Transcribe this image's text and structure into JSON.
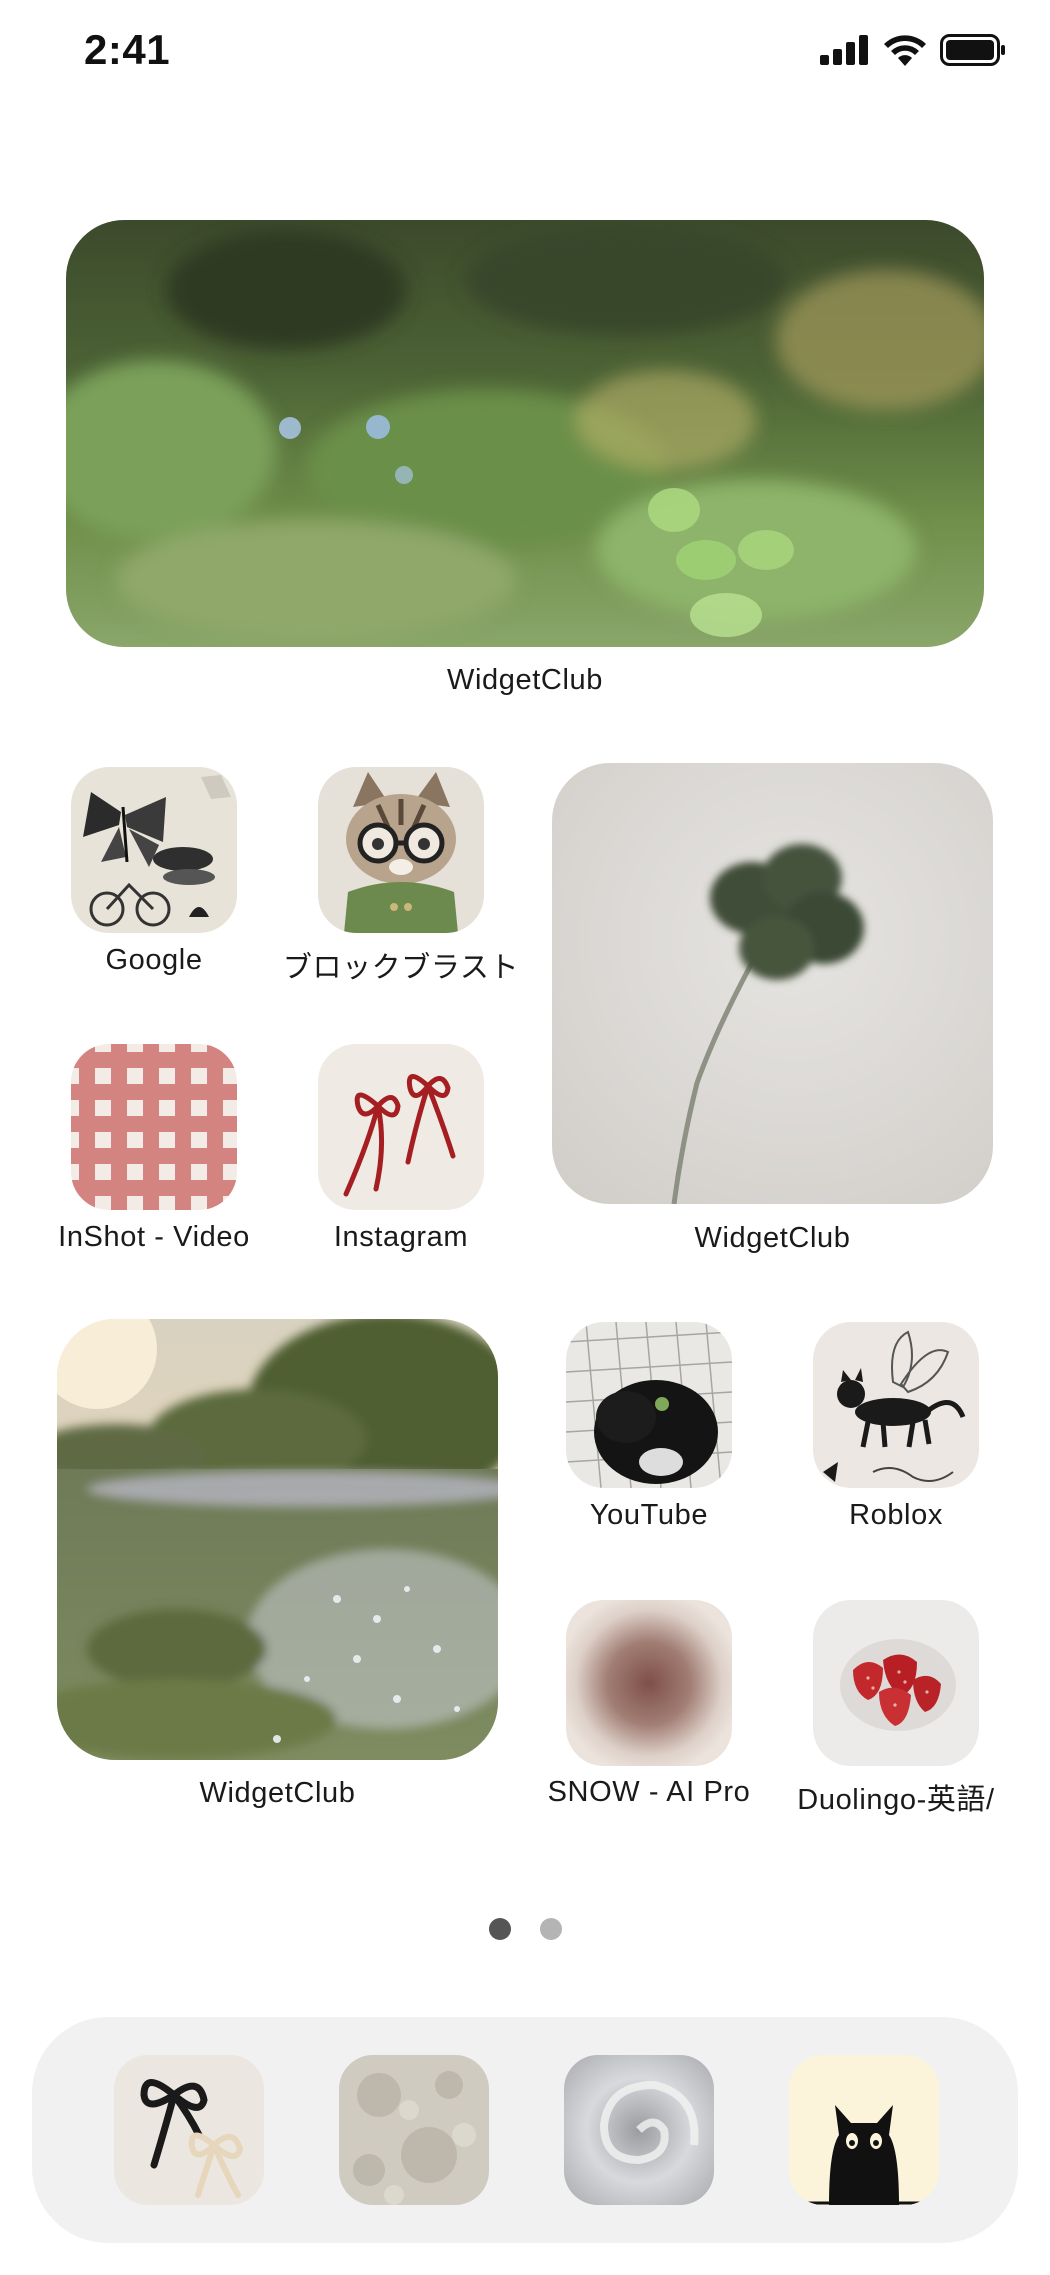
{
  "status_bar": {
    "time": "2:41",
    "icons": [
      "cellular-signal-icon",
      "wifi-icon",
      "battery-icon"
    ]
  },
  "widgets": [
    {
      "label": "WidgetClub",
      "image": "forest-meadow-photo"
    },
    {
      "label": "WidgetClub",
      "image": "four-leaf-clover-photo"
    },
    {
      "label": "WidgetClub",
      "image": "sunset-field-photo"
    }
  ],
  "apps": {
    "google": {
      "label": "Google",
      "image": "butterfly-sketch-icon"
    },
    "block_blast": {
      "label": "ブロックブラスト",
      "image": "cat-with-glasses-icon"
    },
    "inshot": {
      "label": "InShot - Video",
      "image": "red-gingham-icon"
    },
    "instagram": {
      "label": "Instagram",
      "image": "red-bows-icon"
    },
    "youtube": {
      "label": "YouTube",
      "image": "black-cat-grid-icon"
    },
    "roblox": {
      "label": "Roblox",
      "image": "cat-fairy-sketch-icon"
    },
    "snow": {
      "label": "SNOW - AI Pro",
      "image": "blurred-circle-icon"
    },
    "duolingo": {
      "label": "Duolingo-英語/",
      "image": "strawberries-icon"
    }
  },
  "page_indicator": {
    "count": 2,
    "current": 1
  },
  "dock": [
    "bows-icon",
    "moon-surface-icon",
    "silver-swirl-icon",
    "black-cat-icon"
  ],
  "colors": {
    "background": "#ffffff",
    "dock": "#f1f1f1",
    "dot_active": "#555555",
    "dot_inactive": "#b4b4b4"
  }
}
